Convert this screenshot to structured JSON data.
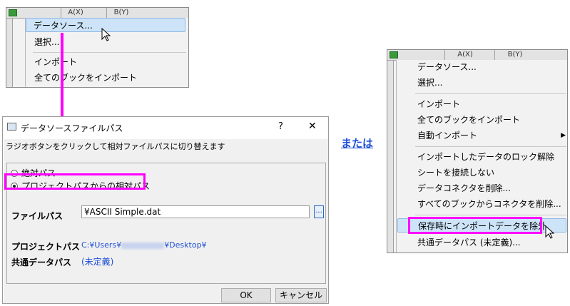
{
  "menu1": {
    "col_headers": [
      "A(X)",
      "B(Y)"
    ],
    "items": [
      {
        "label": "データソース..."
      },
      {
        "label": "選択..."
      },
      {
        "label": "インポート"
      },
      {
        "label": "全てのブックをインポート"
      }
    ]
  },
  "dialog": {
    "title": "データソースファイルパス",
    "help_btn": "?",
    "close_btn": "✕",
    "instruction": "ラジオボタンをクリックして相対ファイルパスに切り替えます",
    "radio_absolute": "絶対パス",
    "radio_relative": "プロジェクトパスからの相対パス",
    "file_path_label": "ファイルパス",
    "file_path_value": "¥ASCII Simple.dat",
    "browse_btn": "...",
    "project_path_label": "プロジェクトパス",
    "project_path_prefix": "C:¥Users¥",
    "project_path_suffix": "¥Desktop¥",
    "shared_path_label": "共通データパス",
    "shared_path_value": "(未定義)",
    "ok": "OK",
    "cancel": "キャンセル"
  },
  "or_label": "または",
  "menu2": {
    "col_headers": [
      "A(X)",
      "B(Y)"
    ],
    "items": [
      {
        "label": "データソース..."
      },
      {
        "label": "選択..."
      },
      {
        "label": "インポート"
      },
      {
        "label": "全てのブックをインポート"
      },
      {
        "label": "自動インポート"
      },
      {
        "label": "インポートしたデータのロック解除"
      },
      {
        "label": "シートを接続しない"
      },
      {
        "label": "データコネクタを削除..."
      },
      {
        "label": "すべてのブックからコネクタを削除..."
      },
      {
        "label": "保存時にインポートデータを除外"
      },
      {
        "label": "共通データパス (未定義)..."
      }
    ]
  },
  "colors": {
    "highlight": "#ff00ff",
    "menu_hover": "#cde3f7",
    "link": "#1f4fd6"
  }
}
